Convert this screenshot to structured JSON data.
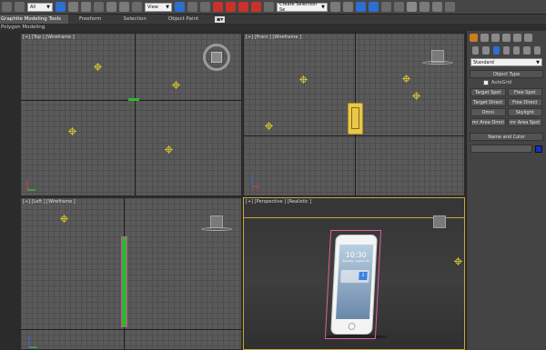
{
  "toolbar": {
    "selection_filter": "All",
    "ref_coord": "View",
    "named_selection": "Create Selection Se",
    "colors": {
      "blue_icon": "#2d6fd0",
      "red_icon": "#c8322a",
      "gray_icon": "#8a8a8a"
    }
  },
  "ribbon": {
    "tabs": [
      "Graphite Modeling Tools",
      "Freeform",
      "Selection",
      "Object Paint"
    ],
    "sub_label": "Polygon Modeling"
  },
  "viewports": {
    "top": {
      "label": "[+] [Top ] [Wireframe ]"
    },
    "front": {
      "label": "[+] [Front ] [Wireframe ]"
    },
    "left": {
      "label": "[+] [Left ] [Wireframe ]"
    },
    "perspective": {
      "label": "[+] [Perspective ] [Realistic ]"
    }
  },
  "phone": {
    "time": "10:30",
    "date": "Tuesday, August 30",
    "tile_text": "2"
  },
  "command_panel": {
    "dropdown": "Standard",
    "object_type_title": "Object Type",
    "autogrid_label": "AutoGrid",
    "buttons": [
      "Target Spot",
      "Free Spot",
      "Target Direct",
      "Free Direct",
      "Omni",
      "Skylight",
      "mr Area Omni",
      "mr Area Spot"
    ],
    "name_color_title": "Name and Color",
    "accent_color": "#d07a1e",
    "swatch_color": "#1030c8"
  }
}
